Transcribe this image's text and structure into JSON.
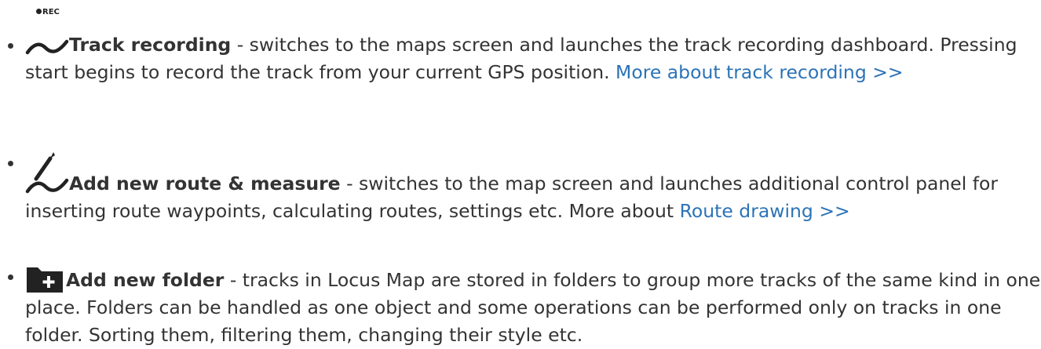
{
  "items": [
    {
      "icon": "track-recording-icon",
      "icon_label": "REC",
      "title": "Track recording",
      "description": " - switches to the maps screen and launches the track recording dashboard. Pressing start begins to record the track from your current GPS position. ",
      "link_text": "More about track recording >>"
    },
    {
      "icon": "route-measure-icon",
      "title": "Add new route & measure",
      "description": " - switches to the map screen and launches additional control panel for inserting route waypoints, calculating routes, settings etc. More about ",
      "link_text": "Route drawing >>"
    },
    {
      "icon": "add-folder-icon",
      "title": "Add new folder",
      "description": " - tracks in Locus Map are stored in folders to group more tracks of the same kind in one place. Folders can be handled as one object and some operations can be performed only on tracks in one folder. Sorting them, filtering them, changing their style etc."
    }
  ],
  "colors": {
    "text": "#333333",
    "link": "#2b73b7",
    "icon": "#222222"
  }
}
